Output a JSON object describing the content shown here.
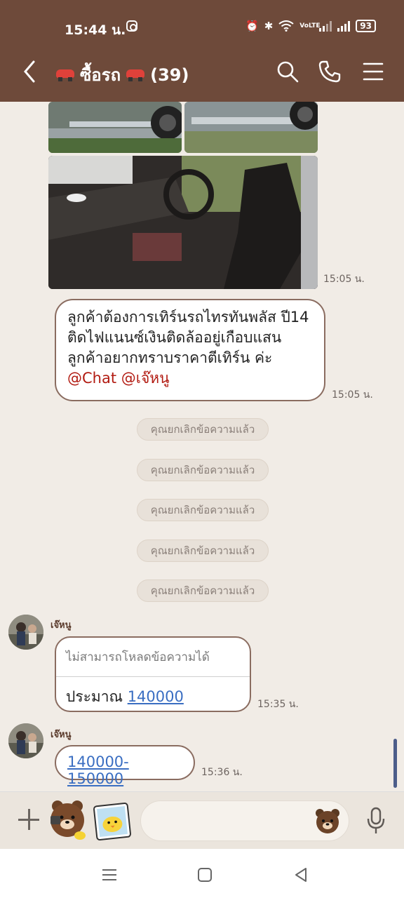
{
  "status": {
    "time": "15:44 น.",
    "battery": "93",
    "network": "VoLTE"
  },
  "header": {
    "title": "ซื้อรถ",
    "count": "(39)"
  },
  "chat": {
    "image_time": "15:05 น.",
    "message1": {
      "text": "ลูกค้าต้องการเทิร์นรถไทรทันพลัส ปี14 ติดไฟแนนซ์เงินติดล้ออยู่เกือบแสน ลูกค้าอยากทราบราคาตีเทิร์น ค่ะ ",
      "mention1": "@Chat",
      "mention2": "@เจ๊หนู",
      "time": "15:05 น."
    },
    "unsent": [
      "คุณยกเลิกข้อความแล้ว",
      "คุณยกเลิกข้อความแล้ว",
      "คุณยกเลิกข้อความแล้ว",
      "คุณยกเลิกข้อความแล้ว",
      "คุณยกเลิกข้อความแล้ว"
    ],
    "reply": {
      "sender": "เจ๊หนู",
      "quote": "ไม่สามารถโหลดข้อความได้",
      "prefix": "ประมาณ ",
      "value": "140000",
      "time": "15:35 น."
    },
    "message3": {
      "sender": "เจ๊หนู",
      "value": "140000-150000",
      "time": "15:36 น."
    }
  },
  "icons": {
    "back": "chevron-left-icon",
    "search": "search-icon",
    "call": "phone-icon",
    "menu": "hamburger-menu-icon",
    "plus": "plus-icon",
    "emoji": "bear-emoji-icon",
    "mic": "microphone-icon"
  },
  "colors": {
    "header": "#6e4a3a",
    "background": "#f1ece6",
    "mention": "#b21b12",
    "link": "#3a6ec2",
    "bubble_border": "#8a6c60"
  }
}
